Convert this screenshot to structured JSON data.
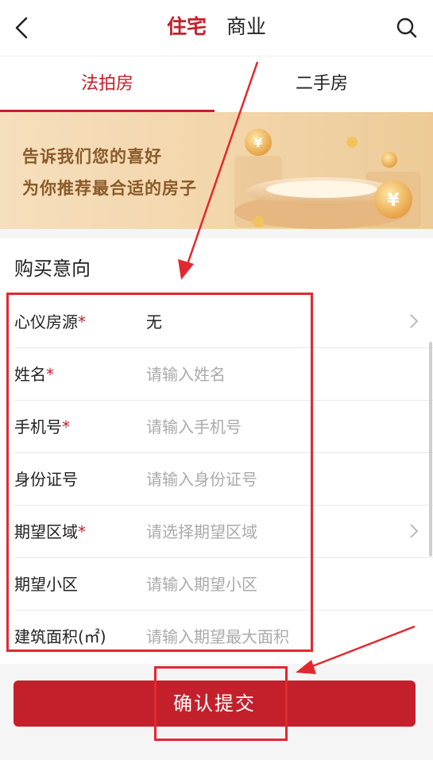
{
  "header": {
    "tabs": [
      {
        "label": "住宅",
        "active": true
      },
      {
        "label": "商业",
        "active": false
      }
    ]
  },
  "subtabs": [
    {
      "label": "法拍房",
      "active": true
    },
    {
      "label": "二手房",
      "active": false
    }
  ],
  "banner": {
    "line1": "告诉我们您的喜好",
    "line2": "为你推荐最合适的房子"
  },
  "form": {
    "section_title": "购买意向",
    "fields": [
      {
        "label": "心仪房源",
        "required": true,
        "value": "无",
        "placeholder": "",
        "has_chevron": true
      },
      {
        "label": "姓名",
        "required": true,
        "value": "",
        "placeholder": "请输入姓名",
        "has_chevron": false
      },
      {
        "label": "手机号",
        "required": true,
        "value": "",
        "placeholder": "请输入手机号",
        "has_chevron": false
      },
      {
        "label": "身份证号",
        "required": false,
        "value": "",
        "placeholder": "请输入身份证号",
        "has_chevron": false
      },
      {
        "label": "期望区域",
        "required": true,
        "value": "",
        "placeholder": "请选择期望区域",
        "has_chevron": true
      },
      {
        "label": "期望小区",
        "required": false,
        "value": "",
        "placeholder": "请输入期望小区",
        "has_chevron": false
      },
      {
        "label": "建筑面积(㎡)",
        "required": false,
        "value": "",
        "placeholder": "请输入期望最大面积",
        "has_chevron": false
      }
    ],
    "required_mark": "*"
  },
  "submit_label": "确认提交",
  "colors": {
    "accent": "#c4202c",
    "annotation": "#e2282f"
  }
}
